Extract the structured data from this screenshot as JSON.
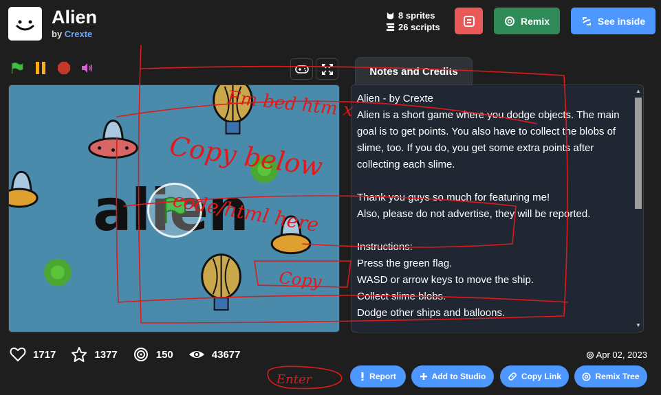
{
  "header": {
    "title": "Alien",
    "by_prefix": "by",
    "author": "Crexte",
    "sprites": "8 sprites",
    "scripts": "26 scripts",
    "remix_label": "Remix",
    "see_inside_label": "See inside"
  },
  "notes": {
    "tab_label": "Notes and Credits",
    "text": "Alien - by Crexte\nAlien is a short game where you dodge objects. The main goal is to get points. You also have to collect the blobs of slime, too. If you do, you get some extra points after collecting each slime.\n\nThank you guys so much for featuring me!\nAlso, please do not advertise, they will be reported.\n\nInstructions:\nPress the green flag.\nWASD or arrow keys to move the ship.\nCollect slime blobs.\nDodge other ships and balloons."
  },
  "stage": {
    "game_title": "alien"
  },
  "footer": {
    "loves": "1717",
    "favorites": "1377",
    "remixes": "150",
    "views": "43677",
    "date": "Apr 02, 2023",
    "report_label": "Report",
    "add_studio_label": "Add to Studio",
    "copy_link_label": "Copy Link",
    "remix_tree_label": "Remix Tree"
  },
  "handwriting": {
    "line1": "Em bed htm x",
    "line2": "Copy below",
    "line3": "code/html here",
    "line4": "Copy",
    "line5": "Enter"
  },
  "colors": {
    "accent": "#4d97ff",
    "remix": "#2e8b57",
    "stage_bg": "#4a8bab",
    "annotation": "#e01a1a"
  }
}
